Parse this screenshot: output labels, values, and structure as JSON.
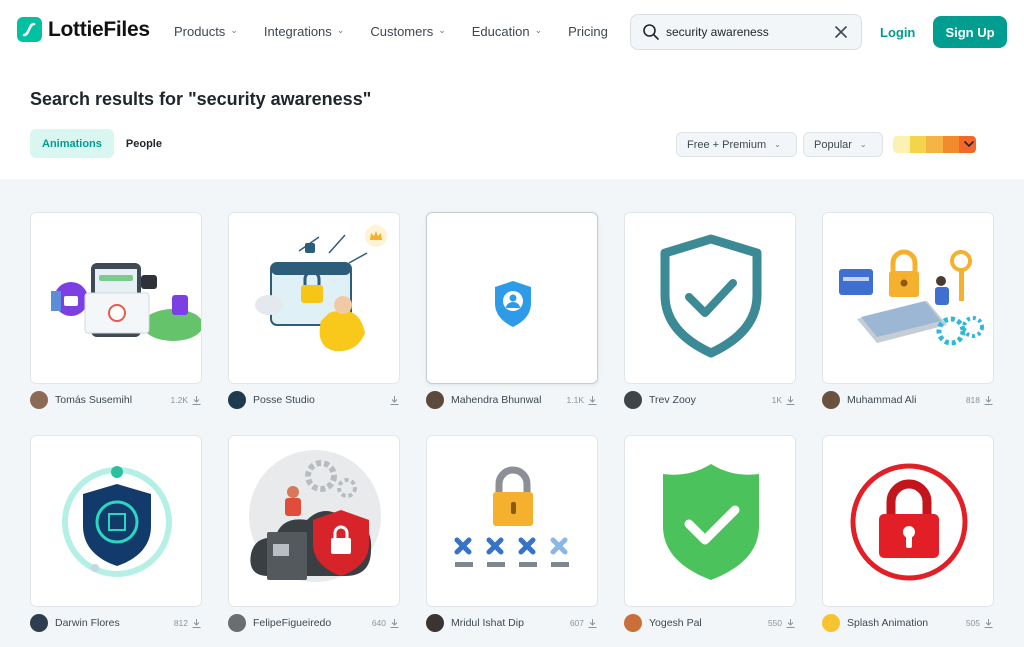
{
  "brand": {
    "name": "LottieFiles",
    "color": "#00c1a2"
  },
  "nav": [
    {
      "label": "Products"
    },
    {
      "label": "Integrations"
    },
    {
      "label": "Customers"
    },
    {
      "label": "Education"
    },
    {
      "label": "Pricing"
    }
  ],
  "search": {
    "value": "security awareness",
    "placeholder": ""
  },
  "auth": {
    "login": "Login",
    "signup": "Sign Up"
  },
  "page": {
    "title": "Search results for \"security awareness\""
  },
  "tabs": [
    {
      "label": "Animations",
      "active": true
    },
    {
      "label": "People",
      "active": false
    }
  ],
  "filters": {
    "license": "Free + Premium",
    "sort": "Popular"
  },
  "palette": [
    "#fbf1b3",
    "#f3d44a",
    "#f5b544",
    "#f18b2c",
    "#f3682a"
  ],
  "results": [
    {
      "author": "Tomás Susemihl",
      "downloads": "1.2K",
      "premium": false
    },
    {
      "author": "Posse Studio",
      "downloads": "",
      "premium": true
    },
    {
      "author": "Mahendra Bhunwal",
      "downloads": "1.1K",
      "premium": false
    },
    {
      "author": "Trev Zooy",
      "downloads": "1K",
      "premium": false
    },
    {
      "author": "Muhammad Ali",
      "downloads": "818",
      "premium": false
    },
    {
      "author": "Darwin Flores",
      "downloads": "812",
      "premium": false
    },
    {
      "author": "FelipeFigueiredo",
      "downloads": "640",
      "premium": false
    },
    {
      "author": "Mridul Ishat Dip",
      "downloads": "607",
      "premium": false
    },
    {
      "author": "Yogesh Pal",
      "downloads": "550",
      "premium": false
    },
    {
      "author": "Splash Animation",
      "downloads": "505",
      "premium": false
    }
  ]
}
